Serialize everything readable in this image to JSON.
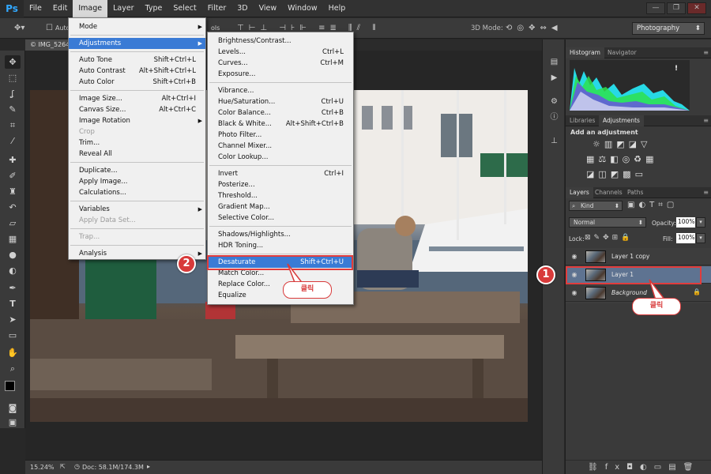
{
  "app": {
    "logo": "Ps"
  },
  "menubar": {
    "items": [
      "File",
      "Edit",
      "Image",
      "Layer",
      "Type",
      "Select",
      "Filter",
      "3D",
      "View",
      "Window",
      "Help"
    ],
    "active": "Image"
  },
  "window_controls": {
    "minimize": "—",
    "restore": "❐",
    "close": "✕"
  },
  "options": {
    "auto_label": "Auto",
    "mode3d": "3D Mode:",
    "workspace": "Photography",
    "peek_text": "ols"
  },
  "document": {
    "tab": "© IMG_5264"
  },
  "status": {
    "zoom": "15.24%",
    "doc": "Doc: 58.1M/174.3M"
  },
  "image_menu": [
    {
      "label": "Mode",
      "shortcut": "",
      "submenu": true
    },
    {
      "sep": true
    },
    {
      "label": "Adjustments",
      "shortcut": "",
      "submenu": true,
      "highlight": true
    },
    {
      "sep": true
    },
    {
      "label": "Auto Tone",
      "shortcut": "Shift+Ctrl+L"
    },
    {
      "label": "Auto Contrast",
      "shortcut": "Alt+Shift+Ctrl+L"
    },
    {
      "label": "Auto Color",
      "shortcut": "Shift+Ctrl+B"
    },
    {
      "sep": true
    },
    {
      "label": "Image Size...",
      "shortcut": "Alt+Ctrl+I"
    },
    {
      "label": "Canvas Size...",
      "shortcut": "Alt+Ctrl+C"
    },
    {
      "label": "Image Rotation",
      "shortcut": "",
      "submenu": true
    },
    {
      "label": "Crop",
      "shortcut": "",
      "disabled": true
    },
    {
      "label": "Trim...",
      "shortcut": ""
    },
    {
      "label": "Reveal All",
      "shortcut": ""
    },
    {
      "sep": true
    },
    {
      "label": "Duplicate...",
      "shortcut": ""
    },
    {
      "label": "Apply Image...",
      "shortcut": ""
    },
    {
      "label": "Calculations...",
      "shortcut": ""
    },
    {
      "sep": true
    },
    {
      "label": "Variables",
      "shortcut": "",
      "submenu": true
    },
    {
      "label": "Apply Data Set...",
      "shortcut": "",
      "disabled": true
    },
    {
      "sep": true
    },
    {
      "label": "Trap...",
      "shortcut": "",
      "disabled": true
    },
    {
      "sep": true
    },
    {
      "label": "Analysis",
      "shortcut": "",
      "submenu": true
    }
  ],
  "adjustments_menu": [
    {
      "label": "Brightness/Contrast...",
      "shortcut": ""
    },
    {
      "label": "Levels...",
      "shortcut": "Ctrl+L"
    },
    {
      "label": "Curves...",
      "shortcut": "Ctrl+M"
    },
    {
      "label": "Exposure...",
      "shortcut": ""
    },
    {
      "sep": true
    },
    {
      "label": "Vibrance...",
      "shortcut": ""
    },
    {
      "label": "Hue/Saturation...",
      "shortcut": "Ctrl+U"
    },
    {
      "label": "Color Balance...",
      "shortcut": "Ctrl+B"
    },
    {
      "label": "Black & White...",
      "shortcut": "Alt+Shift+Ctrl+B"
    },
    {
      "label": "Photo Filter...",
      "shortcut": ""
    },
    {
      "label": "Channel Mixer...",
      "shortcut": ""
    },
    {
      "label": "Color Lookup...",
      "shortcut": ""
    },
    {
      "sep": true
    },
    {
      "label": "Invert",
      "shortcut": "Ctrl+I"
    },
    {
      "label": "Posterize...",
      "shortcut": ""
    },
    {
      "label": "Threshold...",
      "shortcut": ""
    },
    {
      "label": "Gradient Map...",
      "shortcut": ""
    },
    {
      "label": "Selective Color...",
      "shortcut": ""
    },
    {
      "sep": true
    },
    {
      "label": "Shadows/Highlights...",
      "shortcut": ""
    },
    {
      "label": "HDR Toning...",
      "shortcut": ""
    },
    {
      "sep": true
    },
    {
      "label": "Desaturate",
      "shortcut": "Shift+Ctrl+U",
      "highlight": true
    },
    {
      "label": "Match Color...",
      "shortcut": ""
    },
    {
      "label": "Replace Color...",
      "shortcut": ""
    },
    {
      "label": "Equalize",
      "shortcut": ""
    }
  ],
  "panels": {
    "histogram_tabs": [
      "Histogram",
      "Navigator"
    ],
    "histogram_warning": "!",
    "adj_tabs": [
      "Libraries",
      "Adjustments"
    ],
    "adj_title": "Add an adjustment",
    "layers_tabs": [
      "Layers",
      "Channels",
      "Paths"
    ],
    "kind": "Kind",
    "blend_mode": "Normal",
    "opacity_label": "Opacity:",
    "opacity_value": "100%",
    "lock_label": "Lock:",
    "fill_label": "Fill:",
    "fill_value": "100%",
    "layers": [
      {
        "name": "Layer 1 copy",
        "selected": false,
        "locked": false
      },
      {
        "name": "Layer 1",
        "selected": true,
        "locked": false
      },
      {
        "name": "Background",
        "selected": false,
        "locked": true
      }
    ]
  },
  "annotations": {
    "badge1": "1",
    "badge2": "2",
    "callout1": "클릭",
    "callout2": "클릭"
  },
  "colors": {
    "highlight": "#3a7bd5",
    "annotation": "#d83a3a",
    "layer_selected": "#5e7391"
  }
}
